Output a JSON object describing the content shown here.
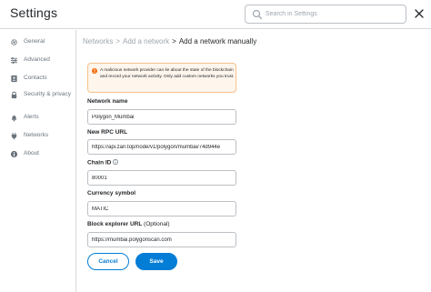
{
  "header": {
    "title": "Settings",
    "search_placeholder": "Search in Settings"
  },
  "sidebar": {
    "items": [
      {
        "label": "General",
        "icon": "gear-icon"
      },
      {
        "label": "Advanced",
        "icon": "sliders-icon"
      },
      {
        "label": "Contacts",
        "icon": "address-book-icon"
      },
      {
        "label": "Security & privacy",
        "icon": "lock-icon"
      },
      {
        "label": "Alerts",
        "icon": "bell-icon"
      },
      {
        "label": "Networks",
        "icon": "plug-icon"
      },
      {
        "label": "About",
        "icon": "info-icon"
      }
    ]
  },
  "breadcrumb": {
    "items": [
      "Networks",
      "Add a network",
      "Add a network manually"
    ],
    "separator": ">"
  },
  "warning": {
    "text": "A malicious network provider can lie about the state of the blockchain and record your network activity. Only add custom networks you trust.",
    "icon": "warning-icon"
  },
  "form": {
    "network_name": {
      "label": "Network name",
      "value": "Polygon_Mumbai"
    },
    "rpc_url": {
      "label": "New RPC URL",
      "value": "https://api.zan.top/node/v1/polygon/mumbai/74d944e"
    },
    "chain_id": {
      "label": "Chain ID",
      "value": "80001"
    },
    "currency_symbol": {
      "label": "Currency symbol",
      "value": "MATIC"
    },
    "block_explorer": {
      "label": "Block explorer URL",
      "optional": "(Optional)",
      "value": "https://mumbai.polygonscan.com"
    }
  },
  "buttons": {
    "cancel": "Cancel",
    "save": "Save"
  },
  "colors": {
    "accent": "#037dd6",
    "warning_bg": "#fef6ec",
    "warning_border": "#f8c08b",
    "muted_text": "#6a737d"
  }
}
